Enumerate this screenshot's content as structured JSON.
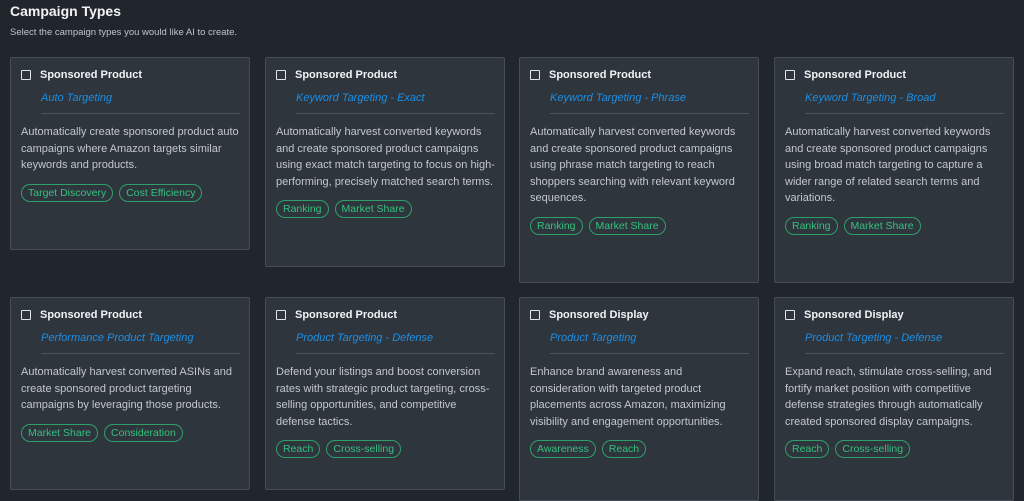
{
  "header": {
    "title": "Campaign Types",
    "subtitle": "Select the campaign types you would like AI to create."
  },
  "colors": {
    "background": "#21252c",
    "card": "#2e353c",
    "accent_blue": "#1c8fe6",
    "tag_green": "#36c07f"
  },
  "cards": [
    {
      "title": "Sponsored Product",
      "subtitle": "Auto Targeting",
      "description": "Automatically create sponsored product auto campaigns where Amazon targets similar keywords and products.",
      "tags": [
        "Target Discovery",
        "Cost Efficiency"
      ]
    },
    {
      "title": "Sponsored Product",
      "subtitle": "Keyword Targeting - Exact",
      "description": "Automatically harvest converted keywords and create sponsored product campaigns using exact match targeting to focus on high-performing, precisely matched search terms.",
      "tags": [
        "Ranking",
        "Market Share"
      ]
    },
    {
      "title": "Sponsored Product",
      "subtitle": "Keyword Targeting - Phrase",
      "description": "Automatically harvest converted keywords and create sponsored product campaigns using phrase match targeting to reach shoppers searching with relevant keyword sequences.",
      "tags": [
        "Ranking",
        "Market Share"
      ]
    },
    {
      "title": "Sponsored Product",
      "subtitle": "Keyword Targeting - Broad",
      "description": "Automatically harvest converted keywords and create sponsored product campaigns using broad match targeting to capture a wider range of related search terms and variations.",
      "tags": [
        "Ranking",
        "Market Share"
      ]
    },
    {
      "title": "Sponsored Product",
      "subtitle": "Performance Product Targeting",
      "description": "Automatically harvest converted ASINs and create sponsored product targeting campaigns by leveraging those products.",
      "tags": [
        "Market Share",
        "Consideration"
      ]
    },
    {
      "title": "Sponsored Product",
      "subtitle": "Product Targeting - Defense",
      "description": "Defend your listings and boost conversion rates with strategic product targeting, cross-selling opportunities, and competitive defense tactics.",
      "tags": [
        "Reach",
        "Cross-selling"
      ]
    },
    {
      "title": "Sponsored Display",
      "subtitle": "Product Targeting",
      "description": "Enhance brand awareness and consideration with targeted product placements across Amazon, maximizing visibility and engagement opportunities.",
      "tags": [
        "Awareness",
        "Reach"
      ]
    },
    {
      "title": "Sponsored Display",
      "subtitle": "Product Targeting - Defense",
      "description": "Expand reach, stimulate cross-selling, and fortify market position with competitive defense strategies through automatically created sponsored display campaigns.",
      "tags": [
        "Reach",
        "Cross-selling"
      ]
    }
  ]
}
